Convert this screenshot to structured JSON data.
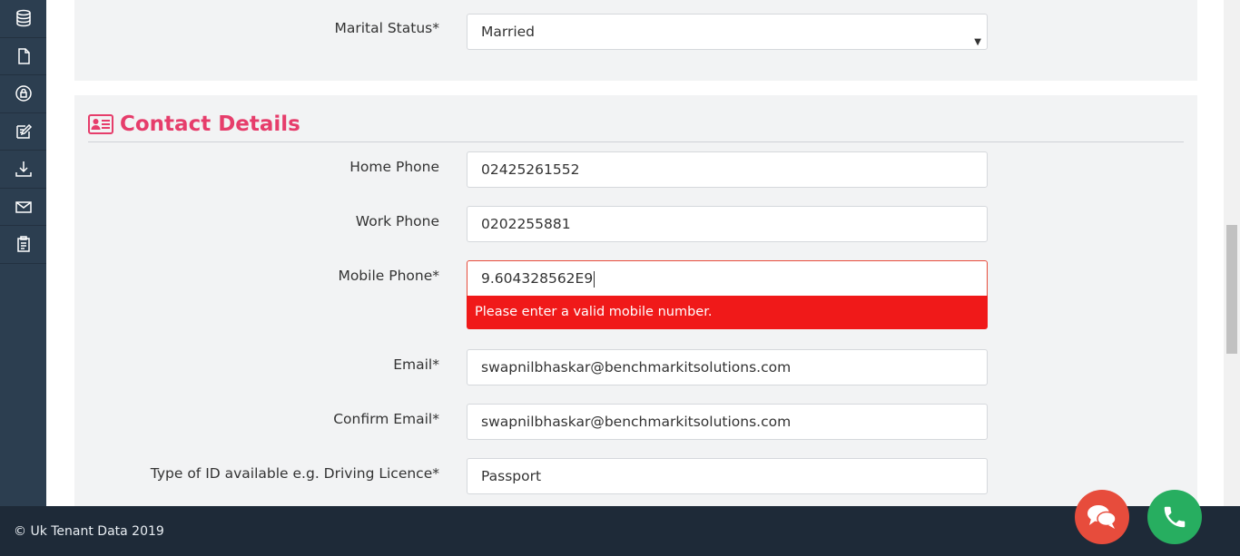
{
  "sidebar": {
    "items": [
      {
        "icon": "database-icon"
      },
      {
        "icon": "file-icon"
      },
      {
        "icon": "lock-circle-icon"
      },
      {
        "icon": "edit-icon"
      },
      {
        "icon": "download-icon"
      },
      {
        "icon": "mail-icon"
      },
      {
        "icon": "clipboard-icon"
      }
    ]
  },
  "marital": {
    "label": "Marital Status*",
    "value": "Married"
  },
  "contact": {
    "title": "Contact Details",
    "home_phone": {
      "label": "Home Phone",
      "value": "02425261552"
    },
    "work_phone": {
      "label": "Work Phone",
      "value": "0202255881"
    },
    "mobile_phone": {
      "label": "Mobile Phone*",
      "value": "9.604328562E9",
      "error": "Please enter a valid mobile number."
    },
    "email": {
      "label": "Email*",
      "value": "swapnilbhaskar@benchmarkitsolutions.com"
    },
    "confirm_email": {
      "label": "Confirm Email*",
      "value": "swapnilbhaskar@benchmarkitsolutions.com"
    },
    "id_type": {
      "label": "Type of ID available e.g. Driving Licence*",
      "value": "Passport"
    }
  },
  "footer": {
    "text": "© Uk Tenant Data 2019"
  },
  "colors": {
    "sidebar_bg": "#2c3e50",
    "accent": "#e63d6b",
    "error": "#f01919",
    "chat_button": "#e74c3c",
    "call_button": "#27ae60",
    "footer_bg": "#1e2a38"
  }
}
